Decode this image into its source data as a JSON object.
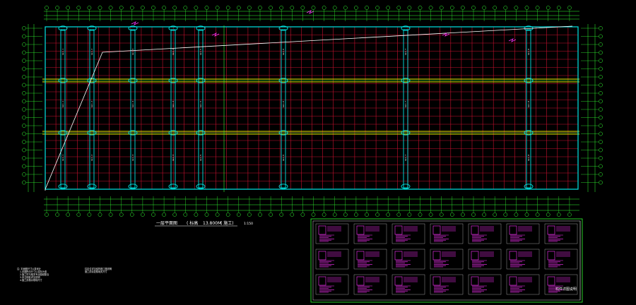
{
  "drawing": {
    "plan_title": "一层平面图",
    "elevation_label": "( 标高",
    "elevation_value": "13.800M",
    "elevation_suffix": "( 施工)",
    "scale": "1:150",
    "legend_title": "构件详图说明",
    "notes": [
      "注: 平面图尺寸以毫米计",
      "1.本图所示尺寸以实际为准",
      "2.施工时与相关专业图纸配合",
      "3.未注明处详见说明",
      "4.施工前核对现场尺寸"
    ],
    "notes_mid": [
      "柱定位详见结构施工图说明",
      "施工前请复核相关尺寸"
    ],
    "column_labels": [
      "GL1-1",
      "GL1-2",
      "GL1-3",
      "GL1-4",
      "GL1-5",
      "GL1-6",
      "GL1-7",
      "GL1-8",
      "GL1-9"
    ]
  },
  "colors": {
    "background": "#000000",
    "grid": "#c8102e",
    "axis": "#33ff33",
    "outline": "#00e5e5",
    "beam": "#e0e000",
    "annotation": "#ff33ff",
    "text": "#ffffff"
  }
}
